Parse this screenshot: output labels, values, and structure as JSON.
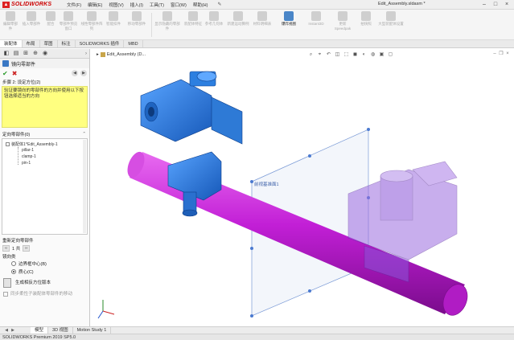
{
  "app": {
    "logo_text": "SOLIDWORKS",
    "doc_title": "Edit_Assembly.sldasm *",
    "menus": [
      "文件(F)",
      "编辑(E)",
      "视图(V)",
      "插入(I)",
      "工具(T)",
      "窗口(W)",
      "帮助(H)"
    ]
  },
  "ribbon": {
    "tools": [
      {
        "label": "编辑零部件"
      },
      {
        "label": "插入零部件"
      },
      {
        "label": "配合"
      },
      {
        "label": "零部件预览窗口"
      },
      {
        "label": "线性零部件阵列"
      },
      {
        "label": "智能扣件"
      },
      {
        "label": "移动零部件"
      },
      {
        "label": "显示隐藏的零部件"
      },
      {
        "label": "装配体特征"
      },
      {
        "label": "参考几何体"
      },
      {
        "label": "新建运动算例"
      },
      {
        "label": "材料明细表"
      },
      {
        "label": "爆炸视图"
      },
      {
        "label": "Instant3D"
      },
      {
        "label": "更新Speedpak"
      },
      {
        "label": "拍快照"
      },
      {
        "label": "大型装配体设置"
      }
    ]
  },
  "command_tabs": [
    "装配体",
    "布局",
    "草图",
    "标注",
    "SOLIDWORKS 插件",
    "MBD"
  ],
  "property_manager": {
    "title": "镜向零部件",
    "step_title": "步骤 2: 设定方位(2)",
    "message": "验证要镜向的零部件的方向并使用以下按钮选择适当的方向",
    "oriented_group_title": "定向零部件(0)",
    "list": {
      "root": "装配体1^Edit_Assembly-1",
      "children": [
        "pillar-1",
        "clamp-1",
        "pin-1"
      ]
    },
    "reorient_label": "重新定向零部件",
    "reorient_value": "1 共",
    "mirror_type_label": "镜向类",
    "radio_options": [
      {
        "label": "边界框中心(B)",
        "checked": false
      },
      {
        "label": "质心(C)",
        "checked": true
      }
    ],
    "generate_label": "生成相反方位版本",
    "sync_label": "同步柔性子装配体零部件的移动"
  },
  "viewport": {
    "tree_label": "Edit_Assembly (D...",
    "plane_label": "前视基准面1"
  },
  "bottom_tabs": [
    "模型",
    "3D 视图",
    "Motion Study 1"
  ],
  "status_text": "SOLIDWORKS Premium 2019 SP5.0",
  "colors": {
    "body_blue": "#2d7fe0",
    "rod_magenta": "#c21fd6",
    "ghost_purple": "#9c6ce0",
    "message_yellow": "#ffff80"
  }
}
